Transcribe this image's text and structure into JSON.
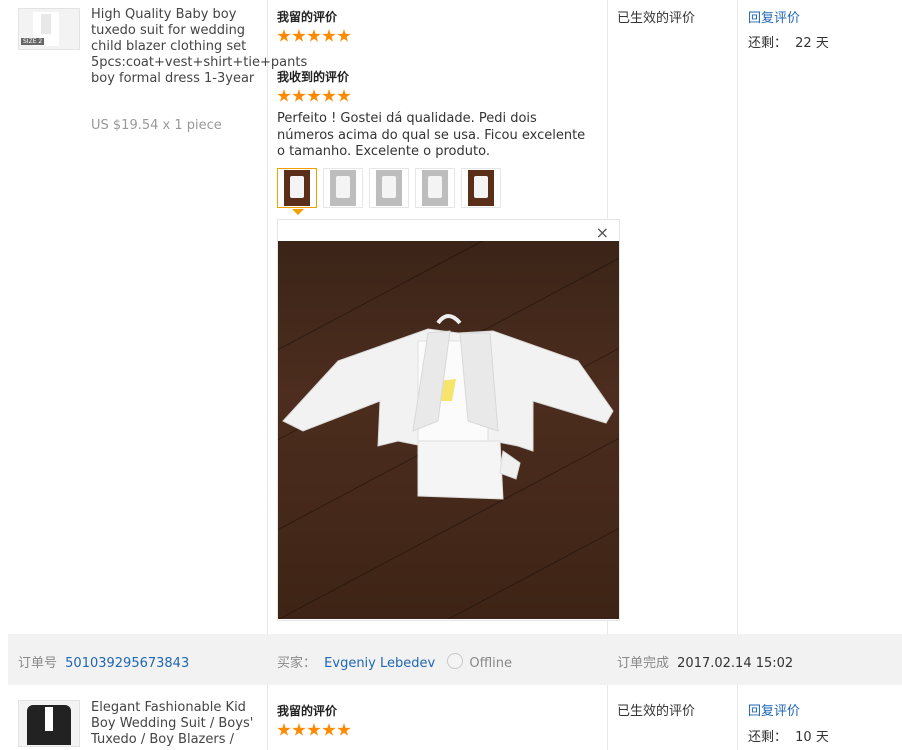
{
  "review1": {
    "product": {
      "title": "High Quality Baby boy tuxedo suit for wedding child blazer clothing set 5pcs:coat+vest+shirt+tie+pants boy formal dress 1-3year",
      "price": "US $19.54 x 1 piece",
      "image_label": "SIZE 2"
    },
    "my_review_label": "我留的评价",
    "received_review_label": "我收到的评价",
    "my_stars": 5,
    "received_stars": 5,
    "received_text": "Perfeito ! Gostei dá qualidade. Pedi dois números acima do qual se usa. Ficou excelente o tamanho. Excelente o produto.",
    "status": "已生效的评价",
    "reply_link": "回复评价",
    "remaining_label": "还剩：",
    "remaining_value": "22 天",
    "close_icon": "×",
    "photo_count": 5
  },
  "order": {
    "number_label": "订单号",
    "number": "501039295673843",
    "buyer_label": "买家：",
    "buyer_name": "Evgeniy Lebedev",
    "buyer_status": "Offline",
    "complete_label": "订单完成",
    "complete_time": "2017.02.14 15:02"
  },
  "review2": {
    "product": {
      "title": "Elegant Fashionable Kid Boy Wedding Suit / Boys' Tuxedo / Boy Blazers /"
    },
    "my_review_label": "我留的评价",
    "my_stars": 5,
    "status": "已生效的评价",
    "reply_link": "回复评价",
    "remaining_label": "还剩：",
    "remaining_value": "10 天"
  },
  "colors": {
    "star": "#ff8a00",
    "link": "#1f66b3",
    "order_bar": "#f2f2f2",
    "active_thumb_border": "#f2a000"
  }
}
